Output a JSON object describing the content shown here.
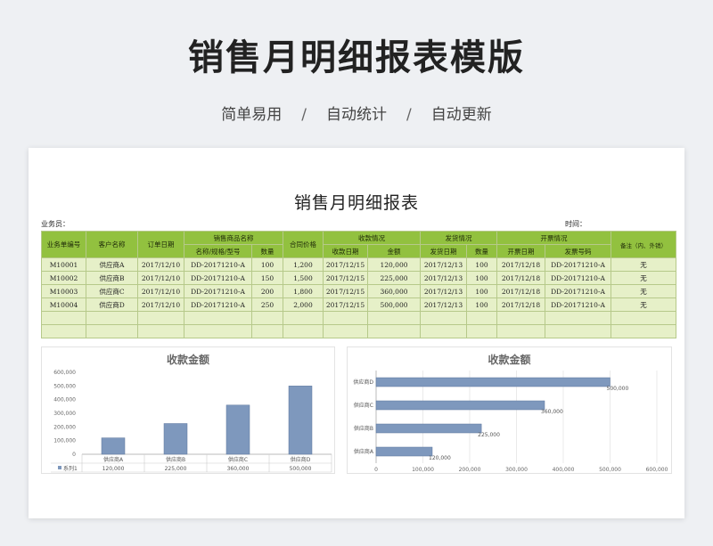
{
  "hero": {
    "title": "销售月明细报表模版",
    "subtitle": [
      "简单易用",
      "自动统计",
      "自动更新"
    ],
    "separator": "/"
  },
  "sheet": {
    "title": "销售月明细报表",
    "salesperson_label": "业务员：",
    "time_label": "时间："
  },
  "table": {
    "headers_top": [
      "业务单编号",
      "客户名称",
      "订单日期",
      "销售商品名称",
      "合同价格",
      "收款情况",
      "发货情况",
      "开票情况",
      "备注（内、外销）"
    ],
    "headers_sub": [
      "名称/规格/型号",
      "数量",
      "收款日期",
      "金额",
      "发货日期",
      "数量",
      "开票日期",
      "发票号码"
    ],
    "rows": [
      [
        "M10001",
        "供应商A",
        "2017/12/10",
        "DD-20171210-A",
        "100",
        "1,200",
        "2017/12/15",
        "120,000",
        "2017/12/13",
        "100",
        "2017/12/18",
        "DD-20171210-A",
        "无"
      ],
      [
        "M10002",
        "供应商B",
        "2017/12/10",
        "DD-20171210-A",
        "150",
        "1,500",
        "2017/12/15",
        "225,000",
        "2017/12/13",
        "100",
        "2017/12/18",
        "DD-20171210-A",
        "无"
      ],
      [
        "M10003",
        "供应商C",
        "2017/12/10",
        "DD-20171210-A",
        "200",
        "1,800",
        "2017/12/15",
        "360,000",
        "2017/12/13",
        "100",
        "2017/12/18",
        "DD-20171210-A",
        "无"
      ],
      [
        "M10004",
        "供应商D",
        "2017/12/10",
        "DD-20171210-A",
        "250",
        "2,000",
        "2017/12/15",
        "500,000",
        "2017/12/13",
        "100",
        "2017/12/18",
        "DD-20171210-A",
        "无"
      ],
      [
        "",
        "",
        "",
        "",
        "",
        "",
        "",
        "",
        "",
        "",
        "",
        "",
        ""
      ],
      [
        "",
        "",
        "",
        "",
        "",
        "",
        "",
        "",
        "",
        "",
        "",
        "",
        ""
      ]
    ]
  },
  "colors": {
    "header_green": "#92c13f",
    "row_green": "#e6f0c8",
    "bar_blue": "#7e98bd"
  },
  "chart_data": [
    {
      "type": "bar",
      "title": "收款金额",
      "categories": [
        "供应商A",
        "供应商B",
        "供应商C",
        "供应商D"
      ],
      "series": [
        {
          "name": "系列1",
          "values": [
            120000,
            225000,
            360000,
            500000
          ]
        }
      ],
      "value_labels": [
        "120,000",
        "225,000",
        "360,000",
        "500,000"
      ],
      "yticks": [
        "600,000",
        "500,000",
        "400,000",
        "300,000",
        "200,000",
        "100,000",
        "0"
      ],
      "ylim": [
        0,
        600000
      ],
      "grid": false,
      "data_table": true
    },
    {
      "type": "bar",
      "orientation": "horizontal",
      "title": "收款金额",
      "categories": [
        "供应商D",
        "供应商C",
        "供应商B",
        "供应商A"
      ],
      "values": [
        500000,
        360000,
        225000,
        120000
      ],
      "value_labels": [
        "500,000",
        "360,000",
        "225,000",
        "120,000"
      ],
      "xticks": [
        "0",
        "100,000",
        "200,000",
        "300,000",
        "400,000",
        "500,000",
        "600,000"
      ],
      "xlim": [
        0,
        600000
      ],
      "grid": true
    }
  ]
}
